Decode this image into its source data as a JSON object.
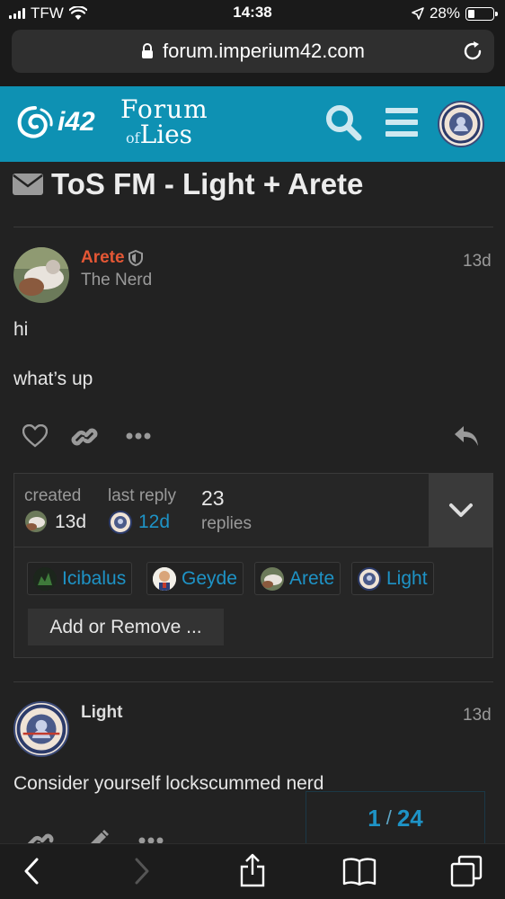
{
  "status_bar": {
    "carrier": "TFW",
    "time": "14:38",
    "battery": "28%",
    "battery_level": 0.28
  },
  "browser": {
    "url": "forum.imperium42.com"
  },
  "site": {
    "logo_short": "i42",
    "logo_forum_line1": "Forum",
    "logo_forum_of": "of",
    "logo_forum_lies": "Lies"
  },
  "topic": {
    "title": "ToS FM - Light + Arete",
    "icon": "envelope-icon"
  },
  "posts": [
    {
      "author": "Arete",
      "author_color": "#e45735",
      "user_title": "The Nerd",
      "age": "13d",
      "lines": [
        "hi",
        "what’s up"
      ]
    },
    {
      "author": "Light",
      "age": "13d",
      "lines": [
        "Consider yourself lockscummed nerd"
      ]
    }
  ],
  "topic_map": {
    "created_label": "created",
    "created_value": "13d",
    "last_reply_label": "last reply",
    "last_reply_value": "12d",
    "replies_count": "23",
    "replies_label": "replies",
    "participants": [
      "Icibalus",
      "Geyde",
      "Arete",
      "Light"
    ],
    "add_remove_label": "Add or Remove ..."
  },
  "progress": {
    "current": "1",
    "total": "24"
  },
  "colors": {
    "header": "#0e91b3",
    "link": "#1e93c6",
    "background": "#222222"
  }
}
